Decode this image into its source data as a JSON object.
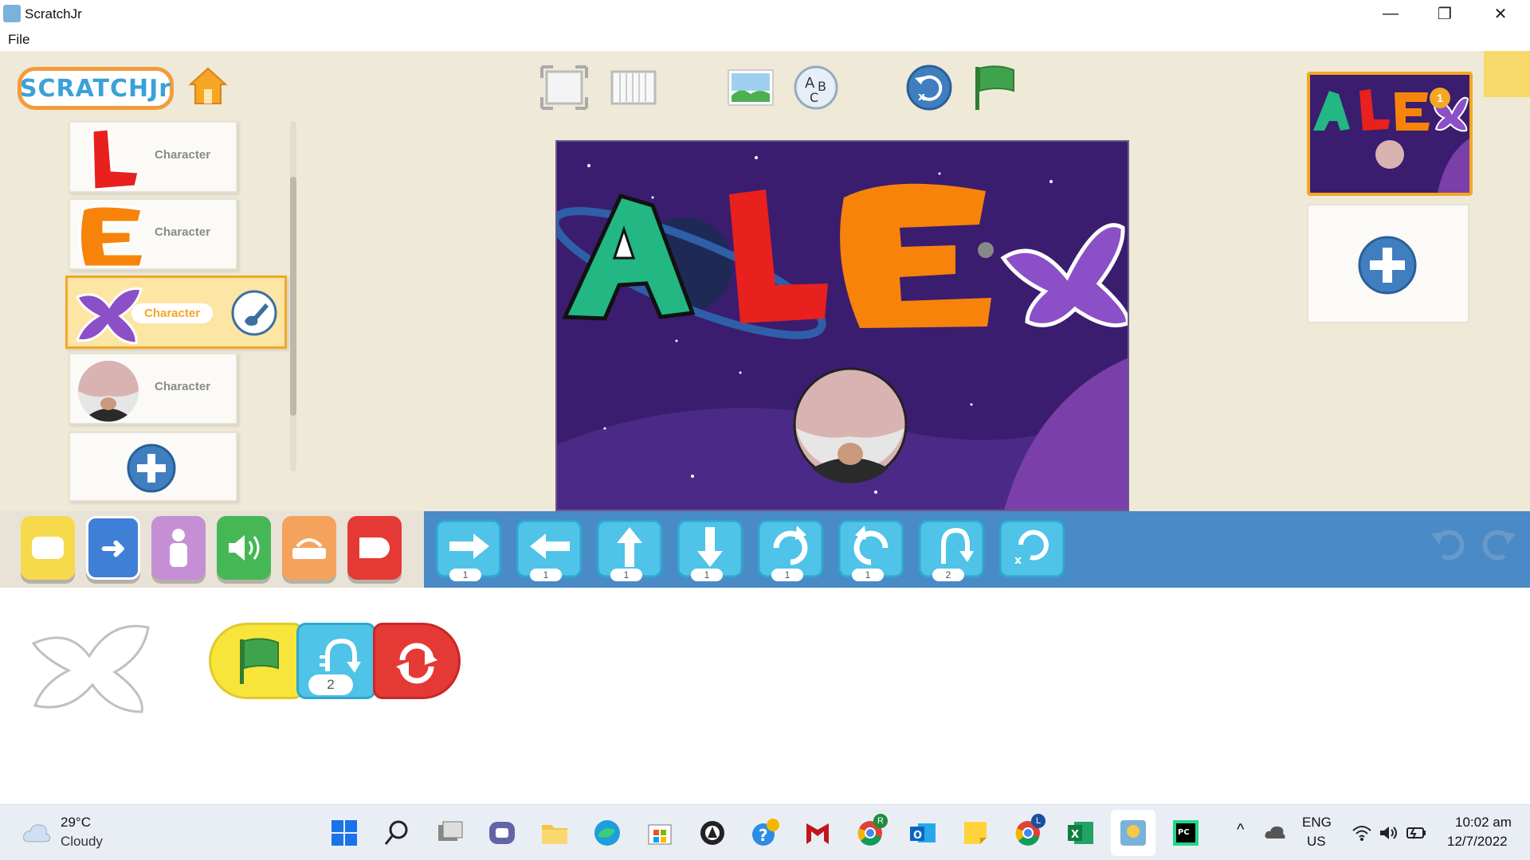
{
  "window": {
    "title": "ScratchJr",
    "controls": [
      "minimize-icon",
      "restore-icon",
      "close-icon"
    ]
  },
  "menu": {
    "file": "File"
  },
  "toolbar": {
    "logo": "SCRATCHJr",
    "icons": [
      "home-icon",
      "presentation-mode-icon",
      "grid-icon",
      "background-icon",
      "text-icon",
      "reset-icon",
      "green-flag-icon"
    ]
  },
  "characters": [
    {
      "glyph": "L",
      "label": "Character",
      "color": "#e8201e",
      "selected": false
    },
    {
      "glyph": "E",
      "label": "Character",
      "color": "#f7830b",
      "selected": false
    },
    {
      "glyph": "X",
      "label": "Character",
      "color": "#8b4fc7",
      "selected": true
    },
    {
      "glyph": "photo",
      "label": "Character",
      "selected": false
    }
  ],
  "stage": {
    "title": "ALEX",
    "colors": {
      "sky": "#3a1d6e",
      "A": "#22b783",
      "L": "#e8201e",
      "E": "#f7830b",
      "X": "#8b4fc7"
    }
  },
  "pages": {
    "thumb_badge": "1"
  },
  "categories": [
    {
      "name": "triggering",
      "color": "#f7d94c"
    },
    {
      "name": "motion",
      "color": "#4a8ac6"
    },
    {
      "name": "looks",
      "color": "#c58fd6"
    },
    {
      "name": "sound",
      "color": "#46b755"
    },
    {
      "name": "control",
      "color": "#f5a35c"
    },
    {
      "name": "end",
      "color": "#e53935"
    }
  ],
  "motion_blocks": [
    {
      "name": "move-right",
      "value": "1"
    },
    {
      "name": "move-left",
      "value": "1"
    },
    {
      "name": "move-up",
      "value": "1"
    },
    {
      "name": "move-down",
      "value": "1"
    },
    {
      "name": "turn-right",
      "value": "1"
    },
    {
      "name": "turn-left",
      "value": "1"
    },
    {
      "name": "hop",
      "value": "2"
    },
    {
      "name": "go-home",
      "value": ""
    }
  ],
  "script": {
    "blocks": [
      {
        "name": "green-flag-trigger"
      },
      {
        "name": "hop",
        "value": "2"
      },
      {
        "name": "repeat-forever"
      }
    ]
  },
  "taskbar": {
    "weather_temp": "29°C",
    "weather_desc": "Cloudy",
    "lang": "ENG",
    "region": "US",
    "time": "10:02 am",
    "date": "12/7/2022",
    "badges": {
      "chrome1": "R",
      "chrome2": "L"
    }
  }
}
